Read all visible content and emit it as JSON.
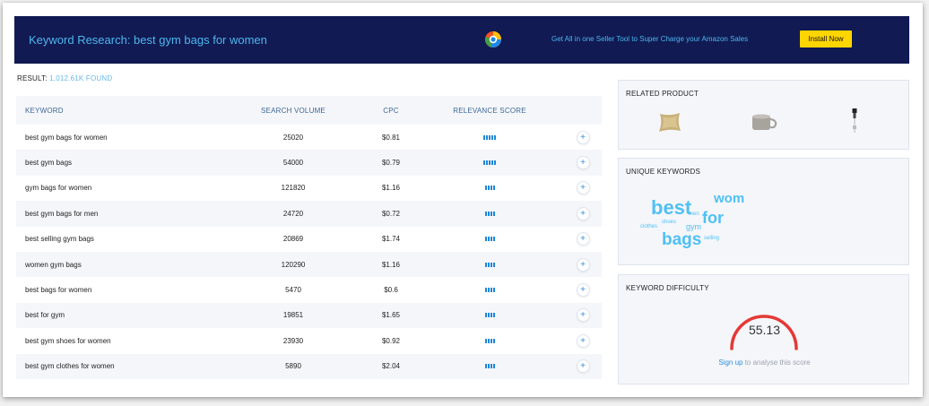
{
  "banner": {
    "title": "Keyword Research: best gym bags for women",
    "promo": "Get All in one Seller Tool to Super Charge your Amazon Sales",
    "install_label": "Install Now"
  },
  "result": {
    "label": "RESULT:",
    "count": "1,012.61K FOUND"
  },
  "table": {
    "headers": [
      "KEYWORD",
      "SEARCH VOLUME",
      "CPC",
      "RELEVANCE SCORE"
    ],
    "rows": [
      {
        "keyword": "best gym bags for women",
        "volume": "25020",
        "cpc": "$0.81",
        "relevance_bars": 5
      },
      {
        "keyword": "best gym bags",
        "volume": "54000",
        "cpc": "$0.79",
        "relevance_bars": 5
      },
      {
        "keyword": "gym bags for women",
        "volume": "121820",
        "cpc": "$1.16",
        "relevance_bars": 4
      },
      {
        "keyword": "best gym bags for men",
        "volume": "24720",
        "cpc": "$0.72",
        "relevance_bars": 4
      },
      {
        "keyword": "best selling gym bags",
        "volume": "20869",
        "cpc": "$1.74",
        "relevance_bars": 4
      },
      {
        "keyword": "women gym bags",
        "volume": "120290",
        "cpc": "$1.16",
        "relevance_bars": 4
      },
      {
        "keyword": "best bags for women",
        "volume": "5470",
        "cpc": "$0.6",
        "relevance_bars": 4
      },
      {
        "keyword": "best for gym",
        "volume": "19851",
        "cpc": "$1.65",
        "relevance_bars": 4
      },
      {
        "keyword": "best gym shoes for women",
        "volume": "23930",
        "cpc": "$0.92",
        "relevance_bars": 4
      },
      {
        "keyword": "best gym clothes for women",
        "volume": "5890",
        "cpc": "$2.04",
        "relevance_bars": 4
      }
    ],
    "add_label": "+"
  },
  "related_product": {
    "title": "RELATED PRODUCT"
  },
  "unique_keywords": {
    "title": "UNIQUE KEYWORDS",
    "words": {
      "best": "best",
      "wom": "wom",
      "for": "for",
      "bags": "bags",
      "gym": "gym",
      "men": "men",
      "shoes": "shoes",
      "clothes": "clothes",
      "selling": "selling"
    }
  },
  "keyword_difficulty": {
    "title": "KEYWORD DIFFICULTY",
    "score": "55.13",
    "score_value": 55.13,
    "signup_link": "Sign up",
    "signup_rest": " to analyse this score"
  },
  "colors": {
    "banner_bg": "#111a52",
    "accent": "#4db6f0",
    "install_btn": "#ffd500",
    "relevance_bar": "#1e86d8",
    "gauge": "#e53935",
    "cloud": "#4fc0f4"
  }
}
